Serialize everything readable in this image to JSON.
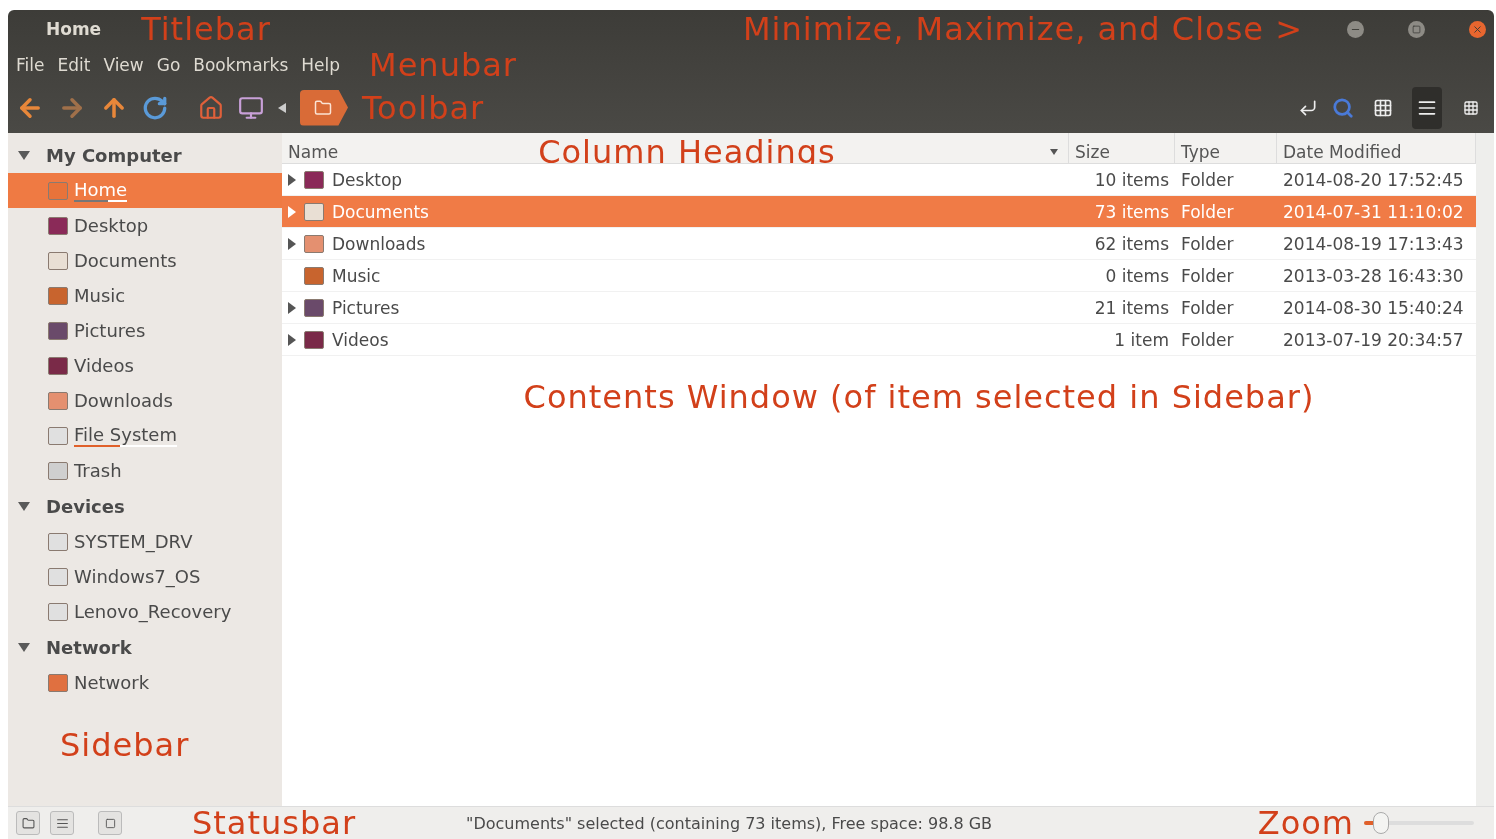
{
  "window": {
    "title": "Home",
    "annotation": "Titlebar",
    "controls_annotation": "Minimize, Maximize, and Close >"
  },
  "menubar": {
    "items": [
      "File",
      "Edit",
      "View",
      "Go",
      "Bookmarks",
      "Help"
    ],
    "annotation": "Menubar"
  },
  "toolbar": {
    "annotation": "Toolbar",
    "views": [
      {
        "kind": "icons",
        "selected": false
      },
      {
        "kind": "list",
        "selected": true
      },
      {
        "kind": "compact",
        "selected": false
      }
    ]
  },
  "sidebar": {
    "annotation": "Sidebar",
    "sections": [
      {
        "title": "My Computer",
        "expanded": true,
        "items": [
          {
            "label": "Home",
            "kind": "home",
            "selected": true,
            "level": 0.64
          },
          {
            "label": "Desktop",
            "kind": "desktop",
            "selected": false
          },
          {
            "label": "Documents",
            "kind": "documents",
            "selected": false
          },
          {
            "label": "Music",
            "kind": "music",
            "selected": false
          },
          {
            "label": "Pictures",
            "kind": "pictures",
            "selected": false
          },
          {
            "label": "Videos",
            "kind": "videos",
            "selected": false
          },
          {
            "label": "Downloads",
            "kind": "downloads",
            "selected": false
          },
          {
            "label": "File System",
            "kind": "drive",
            "selected": false,
            "level": 0.45
          },
          {
            "label": "Trash",
            "kind": "trash",
            "selected": false
          }
        ]
      },
      {
        "title": "Devices",
        "expanded": true,
        "items": [
          {
            "label": "SYSTEM_DRV",
            "kind": "drive",
            "selected": false
          },
          {
            "label": "Windows7_OS",
            "kind": "drive",
            "selected": false
          },
          {
            "label": "Lenovo_Recovery",
            "kind": "drive",
            "selected": false
          }
        ]
      },
      {
        "title": "Network",
        "expanded": true,
        "items": [
          {
            "label": "Network",
            "kind": "network",
            "selected": false
          }
        ]
      }
    ]
  },
  "table": {
    "annotation": "Column Headings",
    "columns": [
      "Name",
      "Size",
      "Type",
      "Date Modified"
    ],
    "rows": [
      {
        "name": "Desktop",
        "kind": "desktop",
        "size": "10 items",
        "type": "Folder",
        "date": "2014-08-20 17:52:45",
        "expandable": true,
        "selected": false
      },
      {
        "name": "Documents",
        "kind": "documents",
        "size": "73 items",
        "type": "Folder",
        "date": "2014-07-31 11:10:02",
        "expandable": true,
        "selected": true
      },
      {
        "name": "Downloads",
        "kind": "downloads",
        "size": "62 items",
        "type": "Folder",
        "date": "2014-08-19 17:13:43",
        "expandable": true,
        "selected": false
      },
      {
        "name": "Music",
        "kind": "music",
        "size": "0 items",
        "type": "Folder",
        "date": "2013-03-28 16:43:30",
        "expandable": false,
        "selected": false
      },
      {
        "name": "Pictures",
        "kind": "pictures",
        "size": "21 items",
        "type": "Folder",
        "date": "2014-08-30 15:40:24",
        "expandable": true,
        "selected": false
      },
      {
        "name": "Videos",
        "kind": "videos",
        "size": "1 item",
        "type": "Folder",
        "date": "2013-07-19 20:34:57",
        "expandable": true,
        "selected": false
      }
    ],
    "contents_annotation": "Contents Window (of item selected in Sidebar)"
  },
  "status_bar": {
    "annotation": "Statusbar",
    "text": "\"Documents\" selected (containing 73 items), Free space: 98.8 GB",
    "zoom_annotation": "Zoom",
    "zoom": {
      "level": 0.1
    }
  }
}
